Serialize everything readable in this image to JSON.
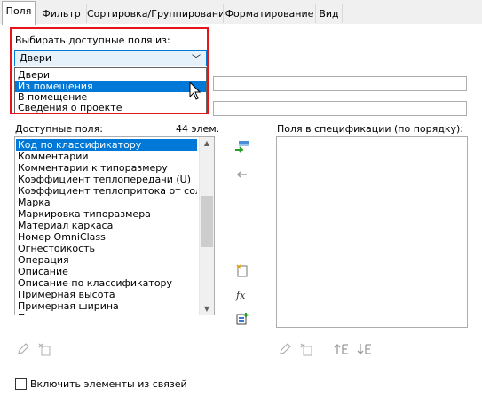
{
  "tabs": [
    "Поля",
    "Фильтр",
    "Сортировка/Группирование",
    "Форматирование",
    "Вид"
  ],
  "source": {
    "label": "Выбирать доступные поля из:",
    "selected": "Двери",
    "options": [
      "Двери",
      "Из помещения",
      "В помещение",
      "Сведения о проекте"
    ],
    "highlighted_index": 1
  },
  "available": {
    "label": "Доступные поля:",
    "count": "44 элем.",
    "items": [
      "Код по классификатору",
      "Комментарии",
      "Комментарии к типоразмеру",
      "Коэффициент теплопередачи (U)",
      "Коэффициент теплопритока от солнечн",
      "Марка",
      "Маркировка типоразмера",
      "Материал каркаса",
      "Номер OmniClass",
      "Огнестойкость",
      "Операция",
      "Описание",
      "Описание по классификатору",
      "Примерная высота",
      "Примерная ширина",
      "П"
    ],
    "selected_index": 0
  },
  "scheduled": {
    "label": "Поля в спецификации (по порядку):",
    "items": []
  },
  "include_links": {
    "label": "Включить элементы из связей",
    "checked": false
  },
  "icons": {
    "add": "add-field-icon",
    "remove": "remove-field-icon",
    "new_param": "new-parameter-icon",
    "calc": "calculated-value-icon",
    "combine": "combine-parameters-icon",
    "edit": "edit-pencil-icon",
    "delete": "delete-icon",
    "move_up": "move-up-icon",
    "move_down": "move-down-icon"
  }
}
